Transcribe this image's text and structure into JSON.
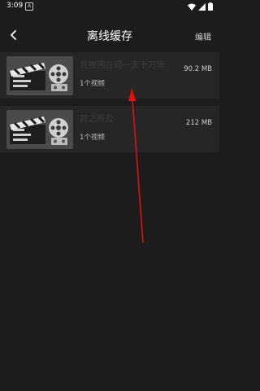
{
  "status": {
    "time": "3:09",
    "notif_letter": "A"
  },
  "header": {
    "title": "离线缓存",
    "edit_label": "编辑"
  },
  "items": [
    {
      "name": "我被困在同一天十万年",
      "count": "1个视频",
      "size": "90.2 MB"
    },
    {
      "name": "目之所及",
      "count": "1个视频",
      "size": "212 MB"
    }
  ],
  "colors": {
    "background": "#1c1c1c",
    "row": "#262626",
    "annotation_arrow": "#e01010"
  }
}
